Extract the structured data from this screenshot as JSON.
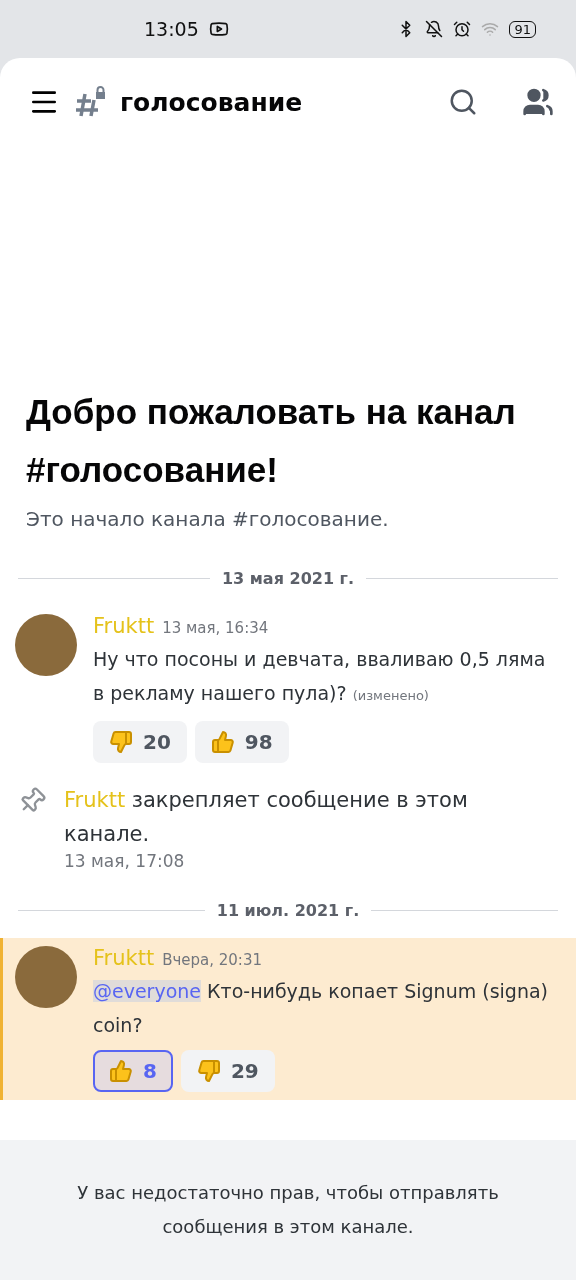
{
  "status_bar": {
    "time": "13:05",
    "battery": "91"
  },
  "header": {
    "channel": "голосование"
  },
  "welcome": {
    "title": "Добро пожаловать на канал #голосование!",
    "subtitle": "Это начало канала #голосование."
  },
  "items": [
    {
      "kind": "divider",
      "label": "13 мая 2021 г."
    },
    {
      "kind": "message",
      "author": "Fruktt",
      "time": "13 мая, 16:34",
      "text": "Ну что посоны и девчата, вваливаю 0,5 ляма в рекламу нашего пула)?",
      "edited": "(изменено)",
      "highlighted": false,
      "reactions": [
        {
          "kind": "down",
          "count": "20",
          "selected": false
        },
        {
          "kind": "up",
          "count": "98",
          "selected": false
        }
      ]
    },
    {
      "kind": "pin",
      "author": "Fruktt",
      "text": "закрепляет сообщение в этом канале.",
      "time": "13 мая, 17:08"
    },
    {
      "kind": "divider",
      "label": "11 июл. 2021 г."
    },
    {
      "kind": "message",
      "author": "Fruktt",
      "time": "Вчера, 20:31",
      "mention": "@everyone",
      "text": "Кто-нибудь копает Signum (signa) coin?",
      "highlighted": true,
      "reactions": [
        {
          "kind": "up",
          "count": "8",
          "selected": true
        },
        {
          "kind": "down",
          "count": "29",
          "selected": false
        }
      ]
    }
  ],
  "footer": {
    "notice": "У вас недостаточно прав, чтобы отправлять сообщения в этом канале."
  }
}
